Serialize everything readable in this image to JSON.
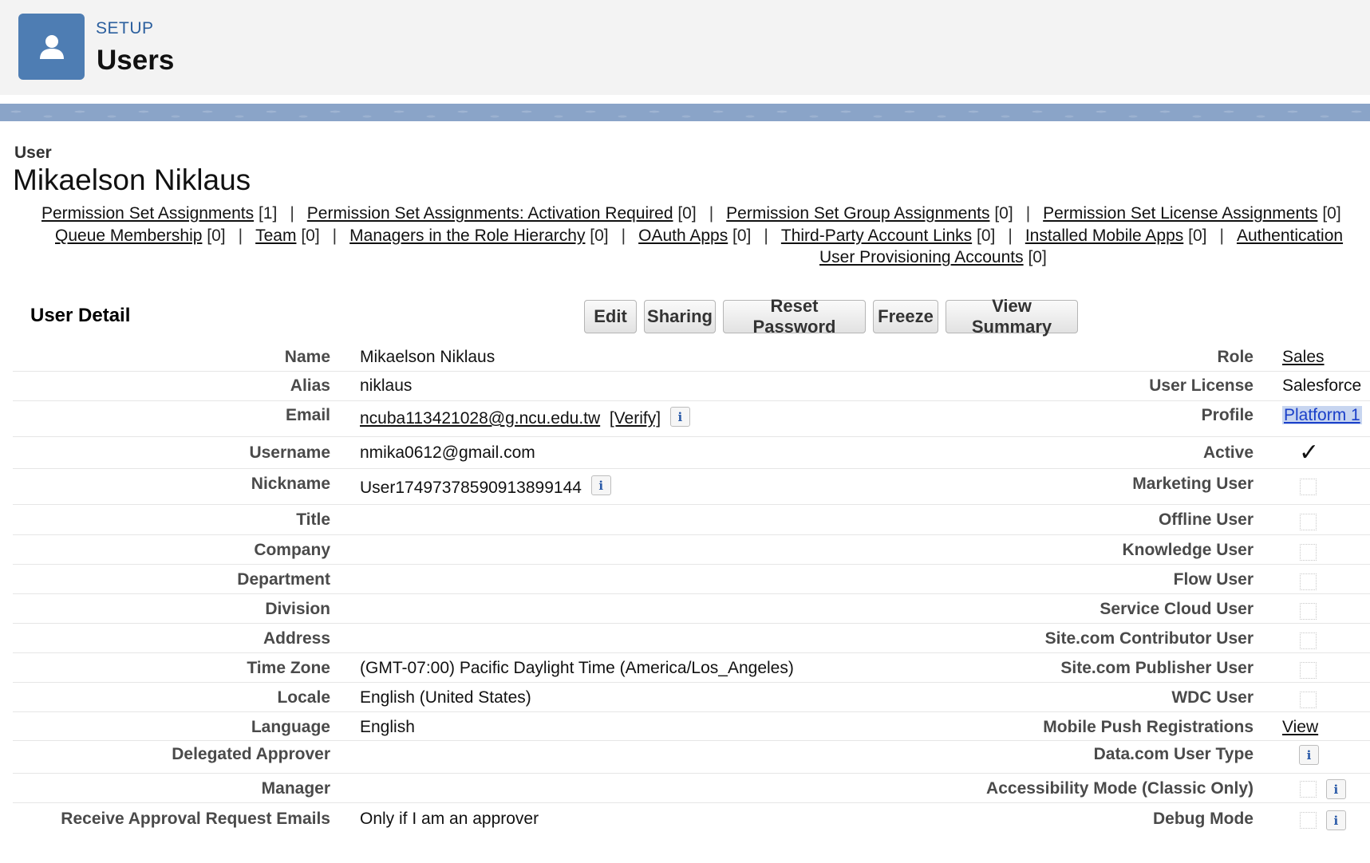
{
  "header": {
    "setup_label": "SETUP",
    "title": "Users",
    "icon": "user-icon"
  },
  "record": {
    "type": "User",
    "name": "Mikaelson Niklaus"
  },
  "related_links": {
    "line1": [
      {
        "label": "Permission Set Assignments",
        "count": "[1]"
      },
      {
        "label": "Permission Set Assignments: Activation Required",
        "count": "[0]"
      },
      {
        "label": "Permission Set Group Assignments",
        "count": "[0]"
      },
      {
        "label": "Permission Set License Assignments",
        "count": "[0]"
      }
    ],
    "line2": [
      {
        "label": "Queue Membership",
        "count": "[0]"
      },
      {
        "label": "Team",
        "count": "[0]"
      },
      {
        "label": "Managers in the Role Hierarchy",
        "count": "[0]"
      },
      {
        "label": "OAuth Apps",
        "count": "[0]"
      },
      {
        "label": "Third-Party Account Links",
        "count": "[0]"
      },
      {
        "label": "Installed Mobile Apps",
        "count": "[0]"
      },
      {
        "label": "Authentication",
        "count": ""
      }
    ],
    "line3": [
      {
        "label": "User Provisioning Accounts",
        "count": "[0]"
      }
    ]
  },
  "detail": {
    "section_title": "User Detail",
    "buttons": [
      "Edit",
      "Sharing",
      "Reset Password",
      "Freeze",
      "View Summary"
    ],
    "left": [
      {
        "label": "Name",
        "value": "Mikaelson Niklaus"
      },
      {
        "label": "Alias",
        "value": "niklaus"
      },
      {
        "label": "Email",
        "value": "ncuba113421028@g.ncu.edu.tw",
        "extra": "[Verify]"
      },
      {
        "label": "Username",
        "value": "nmika0612@gmail.com"
      },
      {
        "label": "Nickname",
        "value": "User17497378590913899144"
      },
      {
        "label": "Title",
        "value": ""
      },
      {
        "label": "Company",
        "value": ""
      },
      {
        "label": "Department",
        "value": ""
      },
      {
        "label": "Division",
        "value": ""
      },
      {
        "label": "Address",
        "value": ""
      },
      {
        "label": "Time Zone",
        "value": "(GMT-07:00) Pacific Daylight Time (America/Los_Angeles)"
      },
      {
        "label": "Locale",
        "value": "English (United States)"
      },
      {
        "label": "Language",
        "value": "English"
      },
      {
        "label": "Delegated Approver",
        "value": ""
      },
      {
        "label": "Manager",
        "value": ""
      },
      {
        "label": "Receive Approval Request Emails",
        "value": "Only if I am an approver"
      }
    ],
    "right": [
      {
        "label": "Role",
        "value": "Sales"
      },
      {
        "label": "User License",
        "value": "Salesforce"
      },
      {
        "label": "Profile",
        "value": "Platform 1"
      },
      {
        "label": "Active",
        "value": "checked"
      },
      {
        "label": "Marketing User",
        "value": "unchecked"
      },
      {
        "label": "Offline User",
        "value": "unchecked"
      },
      {
        "label": "Knowledge User",
        "value": "unchecked"
      },
      {
        "label": "Flow User",
        "value": "unchecked"
      },
      {
        "label": "Service Cloud User",
        "value": "unchecked"
      },
      {
        "label": "Site.com Contributor User",
        "value": "unchecked"
      },
      {
        "label": "Site.com Publisher User",
        "value": "unchecked"
      },
      {
        "label": "WDC User",
        "value": "unchecked"
      },
      {
        "label": "Mobile Push Registrations",
        "value": "View"
      },
      {
        "label": "Data.com User Type",
        "value": ""
      },
      {
        "label": "Accessibility Mode (Classic Only)",
        "value": "unchecked"
      },
      {
        "label": "Debug Mode",
        "value": "unchecked"
      }
    ],
    "info_icon_glyph": "i",
    "check_glyph": "✓"
  }
}
